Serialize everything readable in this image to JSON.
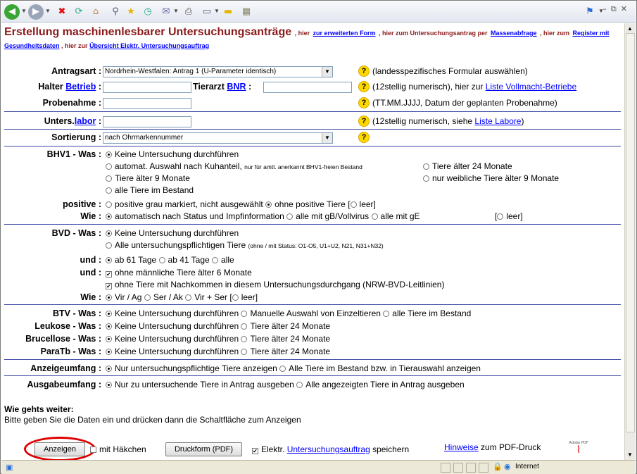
{
  "header": {
    "title": "Erstellung maschinenlesbarer Untersuchungsanträge",
    "seg1": ", hier",
    "link1": "zur erweiterten Form",
    "seg2": ", hier zum Untersuchungsantrag per",
    "link2": "Massenabfrage",
    "seg3": ", hier zum",
    "link3": "Register mit",
    "link3b": "Gesundheitsdaten",
    "seg4": ", hier zur",
    "link4": "Übersicht Elektr. Untersuchungsauftrag"
  },
  "form": {
    "antragsart": {
      "label": "Antragsart :",
      "value": "Nordrhein-Westfalen: Antrag 1 (U-Parameter identisch)",
      "hint": "(landesspezifisches Formular auswählen)"
    },
    "halter": {
      "label": "Halter",
      "link": "Betrieb",
      "colon": ":",
      "tierarzt_label": "Tierarzt",
      "tierarzt_link": "BNR",
      "tierarzt_colon": ":",
      "hint": "(12stellig numerisch), hier zur",
      "hint_link": "Liste Vollmacht-Betriebe"
    },
    "probenahme": {
      "label": "Probenahme :",
      "hint": "(TT.MM.JJJJ, Datum der geplanten Probenahme)"
    },
    "labor": {
      "label": "Unters.",
      "link": "labor",
      "colon": ":",
      "hint": "(12stellig numerisch, siehe",
      "hint_link": "Liste Labore",
      "hint_end": ")"
    },
    "sortierung": {
      "label": "Sortierung :",
      "value": "nach Ohrmarkennummer"
    },
    "qmark": "?"
  },
  "bhv1": {
    "label": "BHV1 - Was :",
    "o1": "Keine Untersuchung durchführen",
    "o2": "automat. Auswahl nach Kuhanteil,",
    "o2_small": "nur für amtl. anerkannt BHV1-freien Bestand",
    "o3": "Tiere älter 24 Monate",
    "o4": "Tiere älter 9 Monate",
    "o5": "nur weibliche Tiere älter 9 Monate",
    "o6": "alle Tiere im Bestand",
    "pos_label": "positive :",
    "pos1": "positive grau markiert, nicht ausgewählt",
    "pos2": "ohne positive Tiere",
    "pos3a": "[",
    "pos3": "leer]",
    "wie_label": "Wie :",
    "wie1": "automatisch nach Status und Impfinformation",
    "wie2": "alle mit gB/Vollvirus",
    "wie3": "alle mit gE",
    "wie4a": "[",
    "wie4": "leer]"
  },
  "bvd": {
    "label": "BVD - Was :",
    "o1": "Keine Untersuchung durchführen",
    "o2": "Alle untersuchungspflichtigen Tiere",
    "o2_small": "(ohne / mit Status: O1-O5, U1+U2, N21, N31+N32)",
    "und1_label": "und :",
    "u1": "ab 61 Tage",
    "u2": "ab 41 Tage",
    "u3": "alle",
    "und2_label": "und :",
    "c1": "ohne männliche Tiere älter 6 Monate",
    "c2": "ohne Tiere mit Nachkommen in diesem Untersuchungsdurchgang (NRW-BVD-Leitlinien)",
    "wie_label": "Wie :",
    "w1": "Vir / Ag",
    "w2": "Ser / Ak",
    "w3": "Vir + Ser",
    "w4a": "[",
    "w4": "leer]"
  },
  "btv": {
    "label": "BTV - Was :",
    "o1": "Keine Untersuchung durchführen",
    "o2": "Manuelle Auswahl von Einzeltieren",
    "o3": "alle Tiere im Bestand"
  },
  "leukose": {
    "label": "Leukose - Was :",
    "o1": "Keine Untersuchung durchführen",
    "o2": "Tiere älter 24 Monate"
  },
  "brucellose": {
    "label": "Brucellose - Was :",
    "o1": "Keine Untersuchung durchführen",
    "o2": "Tiere älter 24 Monate"
  },
  "paratb": {
    "label": "ParaTb - Was :",
    "o1": "Keine Untersuchung durchführen",
    "o2": "Tiere älter 24 Monate"
  },
  "anzeige": {
    "label": "Anzeigeumfang :",
    "o1": "Nur untersuchungspflichtige Tiere anzeigen",
    "o2": "Alle Tiere im Bestand bzw. in Tierauswahl anzeigen"
  },
  "ausgabe": {
    "label": "Ausgabeumfang :",
    "o1": "Nur zu untersuchende Tiere in Antrag ausgeben",
    "o2": "Alle angezeigten Tiere in Antrag ausgeben"
  },
  "footer": {
    "heading": "Wie gehts weiter:",
    "text": "Bitte geben Sie die Daten ein und drücken dann die Schaltfläche zum Anzeigen",
    "btn_show": "Anzeigen",
    "haekchen": "mit Häkchen",
    "btn_print": "Druckform (PDF)",
    "elektr": "Elektr.",
    "elektr_link": "Untersuchungsauftrag",
    "speichern": "speichern",
    "hinweise_link": "Hinweise",
    "hinweise_text": "zum PDF-Druck",
    "adobe": "Adobe PDF"
  },
  "status": {
    "zone": "Internet"
  },
  "colors": {
    "title": "#8b1a1a",
    "link": "#0000ff",
    "separator": "#3c4aa5",
    "highlight": "#e00000"
  }
}
